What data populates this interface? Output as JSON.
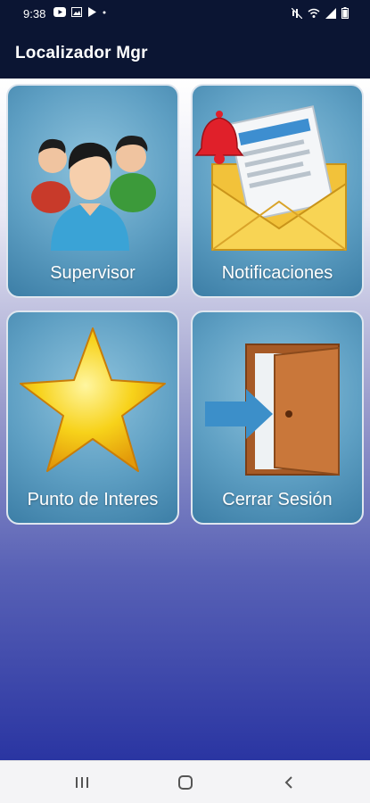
{
  "status_bar": {
    "time": "9:38",
    "left_icons": [
      "youtube-icon",
      "image-icon",
      "play-store-icon",
      "dot-icon"
    ],
    "right_icons": [
      "mute-icon",
      "wifi-icon",
      "signal-icon",
      "battery-icon"
    ]
  },
  "app_bar": {
    "title": "Localizador Mgr"
  },
  "menu": {
    "tiles": [
      {
        "label": "Supervisor",
        "icon": "users-group-icon"
      },
      {
        "label": "Notificaciones",
        "icon": "envelope-bell-icon"
      },
      {
        "label": "Punto de Interes",
        "icon": "star-icon"
      },
      {
        "label": "Cerrar Sesión",
        "icon": "exit-door-icon"
      }
    ]
  },
  "nav_bar": {
    "buttons": [
      "recents-icon",
      "home-icon",
      "back-icon"
    ]
  },
  "colors": {
    "app_bar": "#0b1533",
    "tile": "#5e9fc3",
    "gradient_bottom": "#2a35a2"
  }
}
